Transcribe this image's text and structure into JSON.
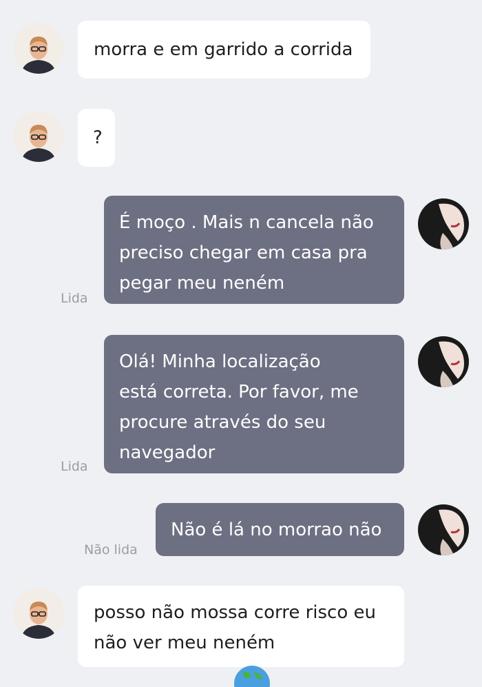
{
  "colors": {
    "background": "#eef0f3",
    "incoming_bubble": "#ffffff",
    "outgoing_bubble": "#6d6f82",
    "status_text": "#9a9da3"
  },
  "messages": [
    {
      "direction": "incoming",
      "lines": [
        "morra e em garrido a corrida"
      ]
    },
    {
      "direction": "incoming",
      "lines": [
        "?"
      ]
    },
    {
      "direction": "outgoing",
      "lines": [
        "É moço . Mais n cancela não",
        "preciso chegar em casa pra",
        "pegar meu neném"
      ],
      "status": "Lida"
    },
    {
      "direction": "outgoing",
      "lines": [
        "Olá! Minha localização",
        "está correta. Por favor, me",
        "procure através do seu",
        "navegador"
      ],
      "status": "Lida"
    },
    {
      "direction": "outgoing",
      "lines": [
        "Não é lá no morrao não"
      ],
      "status": "Não lida"
    },
    {
      "direction": "incoming",
      "lines": [
        "posso não mossa corre risco eu",
        "não ver meu neném"
      ]
    }
  ],
  "icons": {
    "driver_avatar": "man-with-glasses-avatar",
    "passenger_avatar": "woman-profile-avatar",
    "bottom": "globe-icon"
  }
}
